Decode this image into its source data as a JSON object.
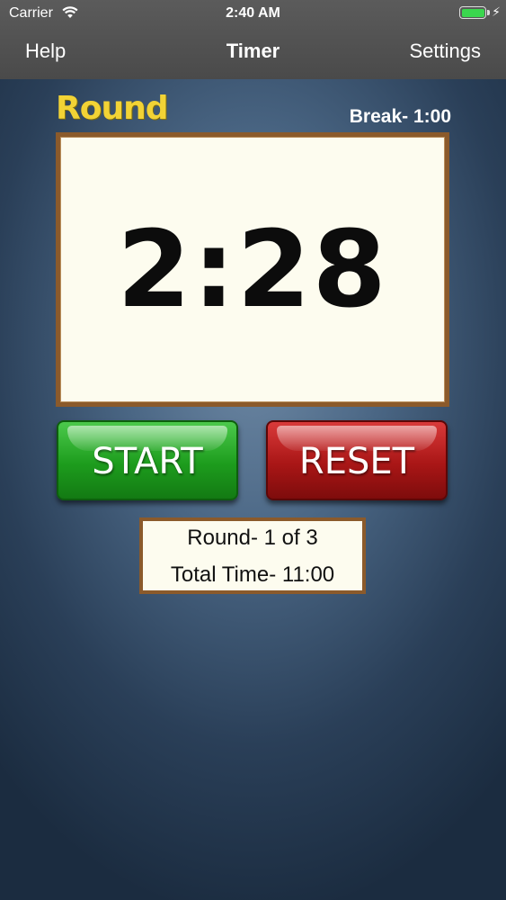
{
  "status_bar": {
    "carrier": "Carrier",
    "time": "2:40 AM",
    "battery_level": 1.0,
    "battery_color": "#3ad64e",
    "wifi_icon": "wifi-icon",
    "charging_icon": "bolt-icon"
  },
  "nav": {
    "left": "Help",
    "title": "Timer",
    "right": "Settings"
  },
  "timer": {
    "mode_label": "Round",
    "break_label": "Break- 1:00",
    "display": "2:28"
  },
  "buttons": {
    "start": "START",
    "reset": "RESET"
  },
  "info": {
    "round": "Round- 1 of 3",
    "total_time": "Total Time- 11:00"
  },
  "colors": {
    "mode_label": "#f2d335",
    "start_button": "#1d9c1d",
    "reset_button": "#a91616",
    "frame": "#8b5a2b"
  }
}
